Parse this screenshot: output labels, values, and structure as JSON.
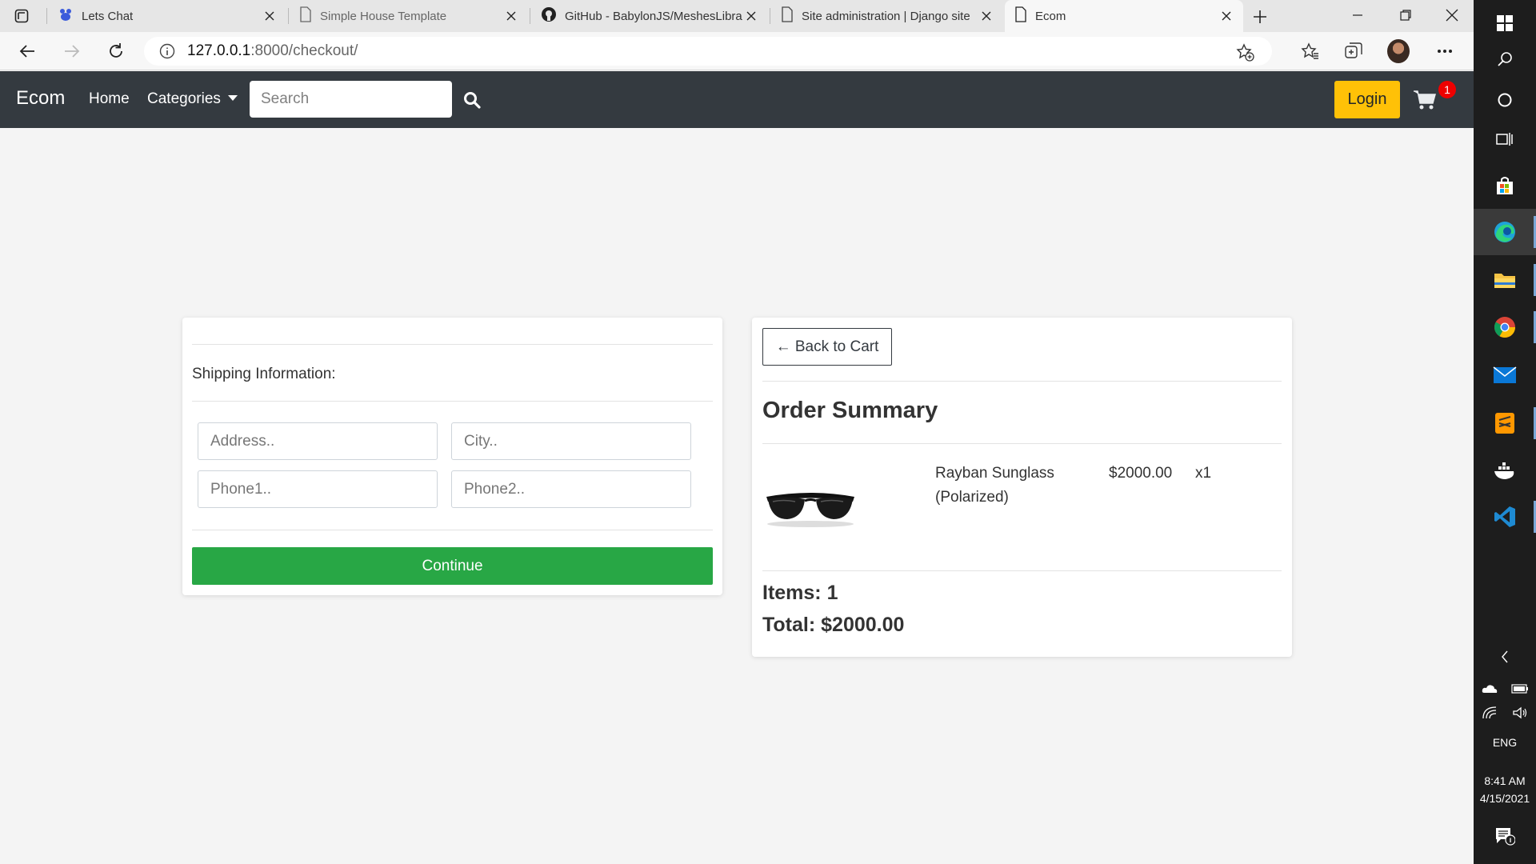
{
  "browser": {
    "tabs": [
      {
        "title": "Lets Chat"
      },
      {
        "title": "Simple House Template"
      },
      {
        "title": "GitHub - BabylonJS/MeshesLibra"
      },
      {
        "title": "Site administration | Django site"
      },
      {
        "title": "Ecom"
      }
    ],
    "url_host": "127.0.0.1",
    "url_path": ":8000/checkout/"
  },
  "nav": {
    "brand": "Ecom",
    "home": "Home",
    "categories": "Categories",
    "search_placeholder": "Search",
    "login": "Login",
    "cart_count": "1"
  },
  "shipping": {
    "label": "Shipping Information:",
    "address_placeholder": "Address..",
    "city_placeholder": "City..",
    "phone1_placeholder": "Phone1..",
    "phone2_placeholder": "Phone2..",
    "continue": "Continue"
  },
  "summary": {
    "back": "← Back to Cart",
    "title": "Order Summary",
    "item": {
      "name": "Rayban Sunglass (Polarized)",
      "price": "$2000.00",
      "qty": "x1"
    },
    "items_line": "Items: 1",
    "total_line": "Total: $2000.00"
  },
  "taskbar": {
    "lang": "ENG",
    "time": "8:41 AM",
    "date": "4/15/2021"
  },
  "colors": {
    "navbar": "#343a40",
    "login": "#ffc107",
    "continue": "#28a745",
    "badge": "#ee0000"
  }
}
